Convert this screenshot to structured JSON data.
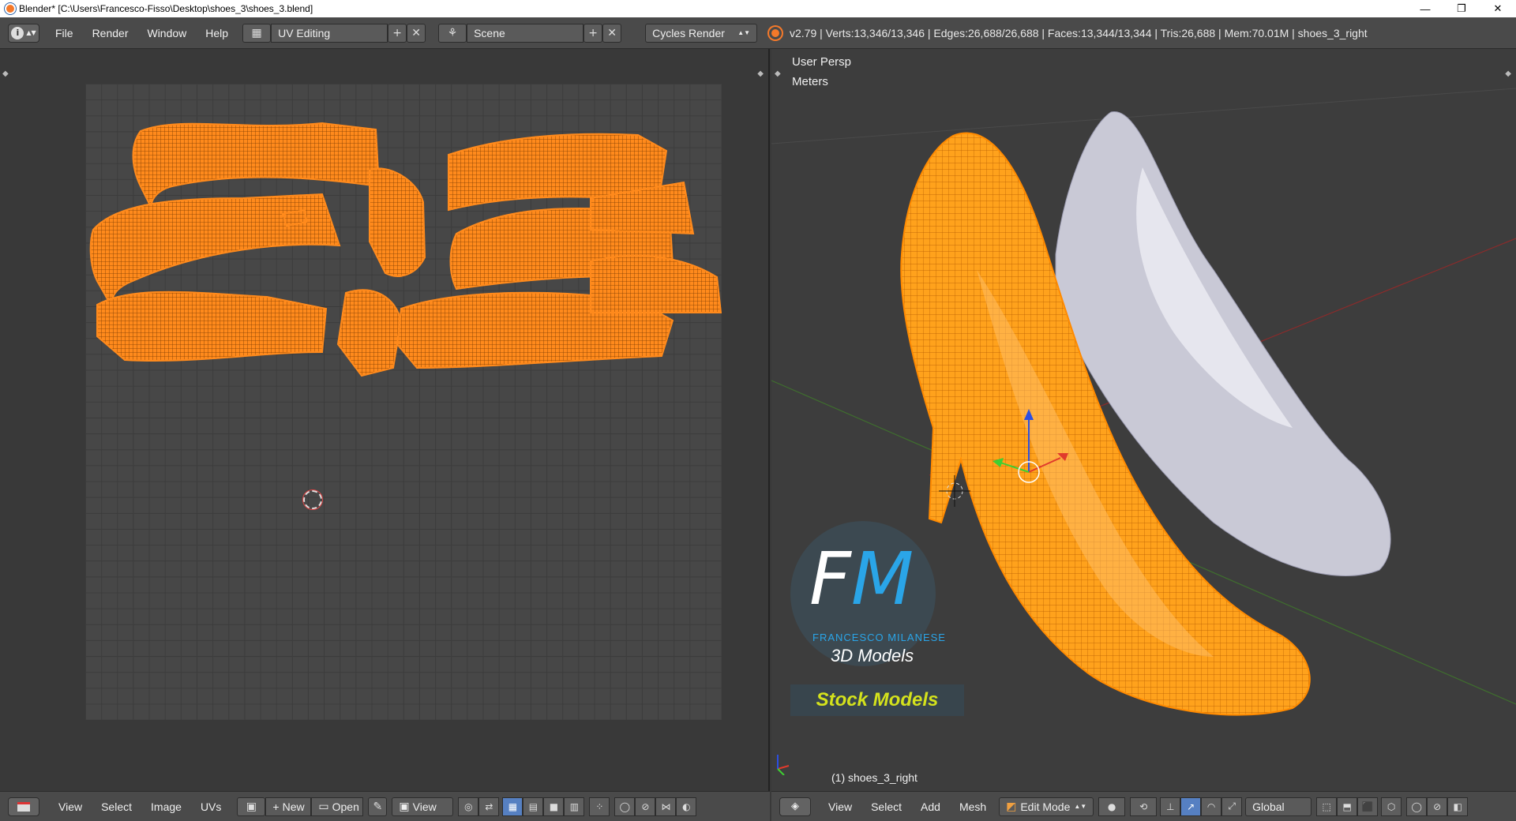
{
  "window": {
    "title": "Blender* [C:\\Users\\Francesco-Fisso\\Desktop\\shoes_3\\shoes_3.blend]",
    "minimize": "—",
    "restore": "❐",
    "close": "✕"
  },
  "topbar": {
    "menus": [
      "File",
      "Render",
      "Window",
      "Help"
    ],
    "screen_layout": "UV Editing",
    "scene": "Scene",
    "render_engine": "Cycles Render",
    "stats": "v2.79 | Verts:13,346/13,346 | Edges:26,688/26,688 | Faces:13,344/13,344 | Tris:26,688 | Mem:70.01M | shoes_3_right"
  },
  "uv_editor": {
    "bottom_menus": [
      "View",
      "Select",
      "Image",
      "UVs"
    ],
    "new_label": "New",
    "open_label": "Open",
    "view_label": "View"
  },
  "viewport": {
    "view_name": "User Persp",
    "units": "Meters",
    "object_label": "(1) shoes_3_right",
    "bottom_menus": [
      "View",
      "Select",
      "Add",
      "Mesh"
    ],
    "mode": "Edit Mode",
    "orientation": "Global"
  },
  "watermark": {
    "brand": "FRANCESCO MILANESE",
    "subtitle": "3D Models",
    "banner": "Stock Models"
  },
  "colors": {
    "uv_orange": "#ff8a1c",
    "edit_orange": "#ffa21c",
    "header_bg": "#4a4a4a",
    "active_blue": "#5680c2"
  }
}
